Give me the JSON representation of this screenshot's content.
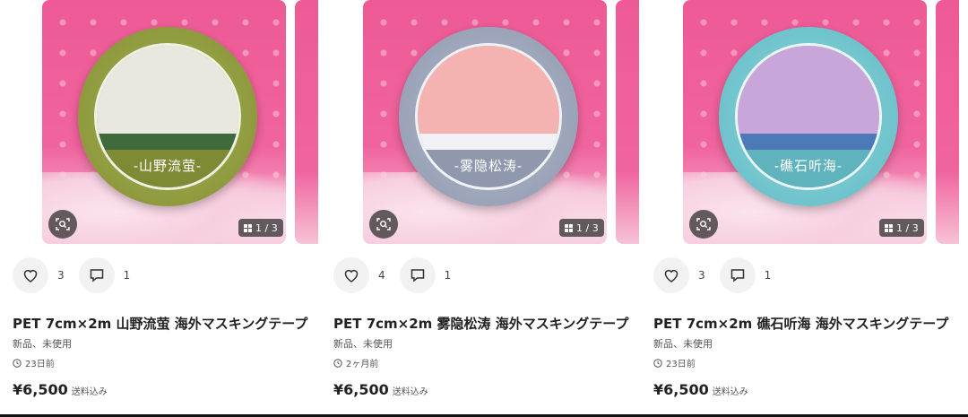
{
  "products": [
    {
      "label": "-山野流萤-",
      "tape_color": "#8e9a3d",
      "tape_ring_color": "#a9b254",
      "sky_color": "#e8e8e0",
      "ground_color": "#3f6a3c",
      "band_color": "#7f8b34",
      "likes": "3",
      "comments": "1",
      "page_indicator": "1 / 3",
      "title": "PET 7cm×2m 山野流萤 海外マスキングテープ",
      "condition": "新品、未使用",
      "time": "23日前",
      "price": "¥6,500",
      "shipping": "送料込み"
    },
    {
      "label": "-雾隐松涛-",
      "tape_color": "#9aa3b8",
      "tape_ring_color": "#b3bacb",
      "sky_color": "#f4b3b0",
      "ground_color": "#f2f2f6",
      "band_color": "#8f98ad",
      "likes": "4",
      "comments": "1",
      "page_indicator": "1 / 3",
      "title": "PET 7cm×2m 雾隐松涛 海外マスキングテープ",
      "condition": "新品、未使用",
      "time": "2ヶ月前",
      "price": "¥6,500",
      "shipping": "送料込み"
    },
    {
      "label": "-礁石听海-",
      "tape_color": "#6fc3cc",
      "tape_ring_color": "#8fd2d9",
      "sky_color": "#c9a6d9",
      "ground_color": "#4e79b8",
      "band_color": "#5fb3bd",
      "likes": "3",
      "comments": "1",
      "page_indicator": "1 / 3",
      "title": "PET 7cm×2m 礁石听海 海外マスキングテープ",
      "condition": "新品、未使用",
      "time": "23日前",
      "price": "¥6,500",
      "shipping": "送料込み"
    }
  ],
  "icons": {
    "scan": "image-search-icon",
    "pages": "grid-icon",
    "like": "heart-icon",
    "comment": "comment-icon",
    "time": "clock-icon"
  }
}
